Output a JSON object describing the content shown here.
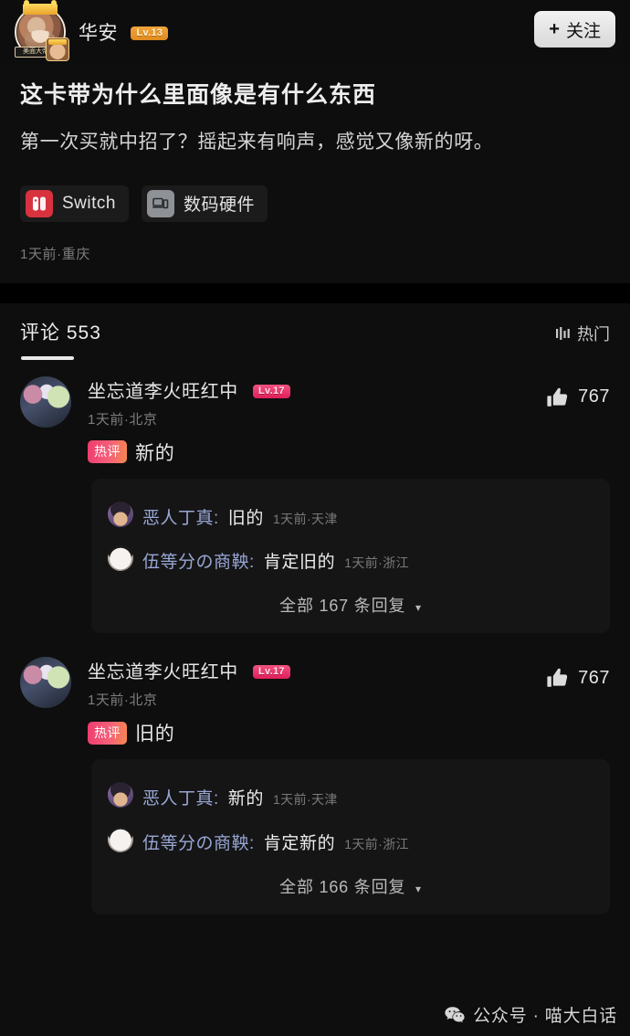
{
  "colors": {
    "page_bg": "#0e0e0e",
    "reply_bg": "#151515",
    "chip_bg": "#1b1b1b",
    "accent_level_orange": "#e8932a",
    "accent_level_pink": "#e01e5a",
    "hot_badge_pink": "#ef3b6e",
    "hot_badge_orange": "#f6874f",
    "reply_name_blue": "#98a6d4",
    "switch_red": "#d8323f",
    "hardware_gray": "#8e9296",
    "muted_text": "#7d7d7d"
  },
  "post": {
    "author": {
      "name": "华安",
      "level_badge": "Lv.13",
      "avatar_name": "author-avatar",
      "avatar_ribbon": "美面大帝"
    },
    "follow_button": {
      "plus": "+",
      "label": "关注"
    },
    "title": "这卡带为什么里面像是有什么东西",
    "text": "第一次买就中招了？摇起来有响声，感觉又像新的呀。",
    "tags": [
      {
        "label": "Switch",
        "icon": "nintendo-switch-icon"
      },
      {
        "label": "数码硬件",
        "icon": "monitor-icon"
      }
    ],
    "meta": "1天前·重庆"
  },
  "comments_section": {
    "tab_label": "评论",
    "count": "553",
    "sort": {
      "label": "热门",
      "icon": "sort-icon"
    },
    "comments": [
      {
        "author": "坐忘道李火旺红中",
        "level_badge": "Lv.17",
        "meta": "1天前·北京",
        "hot_badge": "热评",
        "text": "新的",
        "like_count": "767",
        "like_icon": "thumbs-up-icon",
        "replies": [
          {
            "name": "恶人丁真:",
            "text": "旧的",
            "meta": "1天前·天津",
            "avatar": "reply-avatar-a"
          },
          {
            "name": "伍等分の商鞅:",
            "text": "肯定旧的",
            "meta": "1天前·浙江",
            "avatar": "reply-avatar-b"
          }
        ],
        "more_replies": "全部 167 条回复",
        "more_caret": "▾"
      },
      {
        "author": "坐忘道李火旺红中",
        "level_badge": "Lv.17",
        "meta": "1天前·北京",
        "hot_badge": "热评",
        "text": "旧的",
        "like_count": "767",
        "like_icon": "thumbs-up-icon",
        "replies": [
          {
            "name": "恶人丁真:",
            "text": "新的",
            "meta": "1天前·天津",
            "avatar": "reply-avatar-a"
          },
          {
            "name": "伍等分の商鞅:",
            "text": "肯定新的",
            "meta": "1天前·浙江",
            "avatar": "reply-avatar-b"
          }
        ],
        "more_replies": "全部 166 条回复",
        "more_caret": "▾"
      }
    ]
  },
  "watermark": {
    "icon": "wechat-icon",
    "text": "公众号 · 喵大白话"
  }
}
